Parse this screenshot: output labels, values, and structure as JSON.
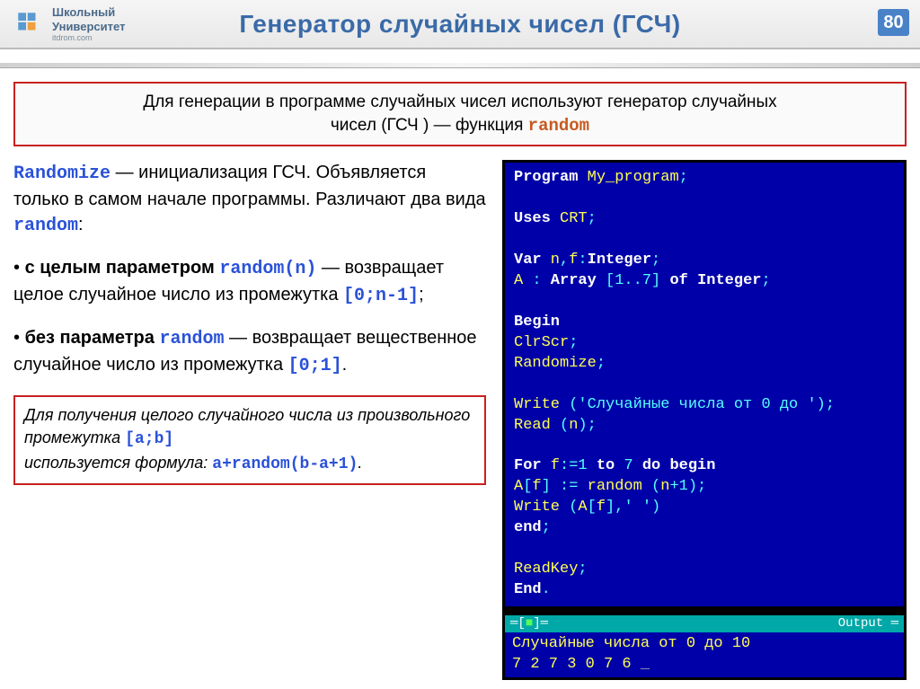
{
  "header": {
    "logo_line1": "Школьный",
    "logo_line2": "Университет",
    "logo_sub": "itdrom.com",
    "title": "Генератор случайных чисел  (ГСЧ)",
    "page_number": "80"
  },
  "intro": {
    "line1": "Для генерации в программе случайных чисел используют генератор случайных",
    "line2_a": "чисел (ГСЧ ) — функция ",
    "line2_b": "random"
  },
  "left": {
    "p1_a": "Randomize",
    "p1_b": " —  инициализация ГСЧ. Объявляется только в самом начале программы. Различают два вида ",
    "p1_c": "random",
    "p1_d": ":",
    "p2_a": "• ",
    "p2_b": "с целым параметром ",
    "p2_c": "random(n)",
    "p2_d": " — возвращает целое случайное число из промежутка ",
    "p2_e": "[0;n-1]",
    "p2_f": ";",
    "p3_a": "• ",
    "p3_b": "без параметра ",
    "p3_c": "random",
    "p3_d": " — возвращает вещественное случайное число из промежутка ",
    "p3_e": "[0;1]",
    "p3_f": "."
  },
  "note": {
    "l1_a": "Для получения целого случайного числа из произвольного промежутка ",
    "l1_b": "[a;b]",
    "l2_a": "используется формула: ",
    "l2_b": "a+random(b-a+1)",
    "l2_c": "."
  },
  "code": {
    "l1a": "Program",
    "l1b": " My_program",
    "l1c": ";",
    "l2a": "Uses",
    "l2b": " CRT",
    "l2c": ";",
    "l3a": "Var",
    "l3b": " n",
    "l3c": ",",
    "l3d": "f",
    "l3e": ":",
    "l3f": "Integer",
    "l3g": ";",
    "l4a": "    A ",
    "l4b": ":",
    "l4c": " Array ",
    "l4d": "[1..7]",
    "l4e": " of ",
    "l4f": "Integer",
    "l4g": ";",
    "l5a": "Begin",
    "l6a": "  ClrScr",
    "l6b": ";",
    "l7a": "  Randomize",
    "l7b": ";",
    "l8a": "  Write ",
    "l8b": "(",
    "l8c": "'Случайные числа от 0 до '",
    "l8d": ");",
    "l9a": "  Read ",
    "l9b": "(",
    "l9c": "n",
    "l9d": ");",
    "l10a": "  For",
    "l10b": " f",
    "l10c": ":=1",
    "l10d": " to ",
    "l10e": "7",
    "l10f": " do ",
    "l10g": "begin",
    "l11a": "    A",
    "l11b": "[",
    "l11c": "f",
    "l11d": "] := ",
    "l11e": "random ",
    "l11f": "(",
    "l11g": "n",
    "l11h": "+1);",
    "l12a": "    Write ",
    "l12b": "(",
    "l12c": "A",
    "l12d": "[",
    "l12e": "f",
    "l12f": "],",
    "l12g": "' '",
    "l12h": ")",
    "l13a": "  end",
    "l13b": ";",
    "l14a": "  ReadKey",
    "l14b": ";",
    "l15a": "End",
    "l15b": "."
  },
  "output": {
    "header_left_open": "═[",
    "header_left_sq": "■",
    "header_left_close": "]═",
    "header_right": "Output ═",
    "line1": "Случайные числа от 0 до 10",
    "line2": "7 2 7 3 0 7 6 ",
    "cursor": "_"
  }
}
